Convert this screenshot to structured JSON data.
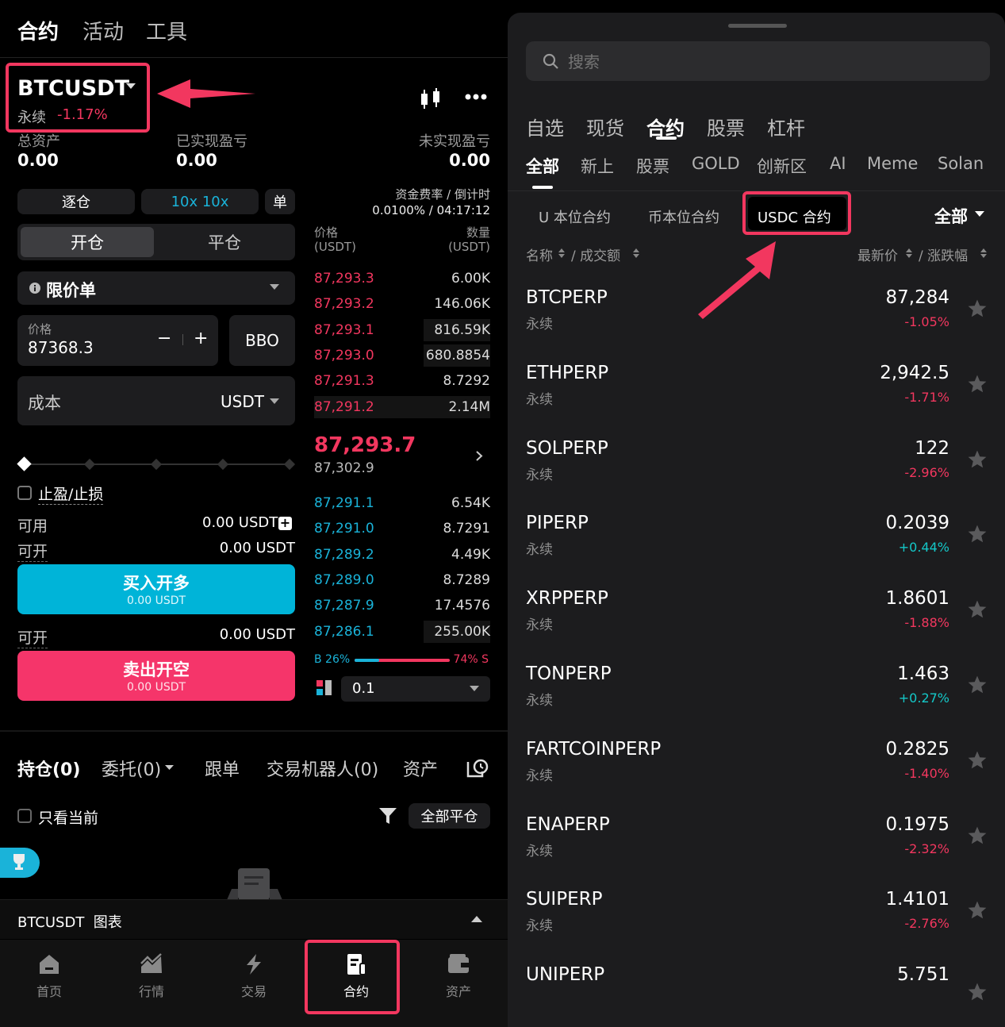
{
  "top_tabs": [
    "合约",
    "活动",
    "工具"
  ],
  "pair": {
    "symbol": "BTCUSDT",
    "type": "永续",
    "change": "-1.17%"
  },
  "account": {
    "total_label": "总资产",
    "total_value": "0.00",
    "realized_label": "已实现盈亏",
    "realized_value": "0.00",
    "unrealized_label": "未实现盈亏",
    "unrealized_value": "0.00"
  },
  "margin": {
    "mode": "逐仓",
    "leverage": "10x 10x",
    "single": "单"
  },
  "funding": {
    "label": "资金费率 / 倒计时",
    "value": "0.0100% / 04:17:12"
  },
  "open_close": {
    "open": "开仓",
    "close": "平仓"
  },
  "order_type": "限价单",
  "price_input": {
    "label": "价格",
    "value": "87368.3",
    "minus": "−",
    "plus": "+",
    "bbo": "BBO"
  },
  "cost": {
    "label": "成本",
    "unit": "USDT"
  },
  "tpsl": "止盈/止损",
  "available": {
    "label": "可用",
    "value": "0.00 USDT"
  },
  "can_open_1": {
    "label": "可开",
    "value": "0.00 USDT"
  },
  "buy_btn": {
    "label": "买入开多",
    "sub": "0.00 USDT"
  },
  "can_open_2": {
    "label": "可开",
    "value": "0.00 USDT"
  },
  "sell_btn": {
    "label": "卖出开空",
    "sub": "0.00 USDT"
  },
  "orderbook": {
    "price_head": "价格\n(USDT)",
    "qty_head": "数量\n(USDT)",
    "asks": [
      {
        "p": "87,293.3",
        "q": "6.00K",
        "w": 0
      },
      {
        "p": "87,293.2",
        "q": "146.06K",
        "w": 0
      },
      {
        "p": "87,293.1",
        "q": "816.59K",
        "w": 0.38
      },
      {
        "p": "87,293.0",
        "q": "680.8854",
        "w": 0.38
      },
      {
        "p": "87,291.3",
        "q": "8.7292",
        "w": 0
      },
      {
        "p": "87,291.2",
        "q": "2.14M",
        "w": 1
      }
    ],
    "last_price": "87,293.7",
    "mark_price": "87,302.9",
    "bids": [
      {
        "p": "87,291.1",
        "q": "6.54K",
        "w": 0
      },
      {
        "p": "87,291.0",
        "q": "8.7291",
        "w": 0
      },
      {
        "p": "87,289.2",
        "q": "4.49K",
        "w": 0
      },
      {
        "p": "87,289.0",
        "q": "8.7289",
        "w": 0
      },
      {
        "p": "87,287.9",
        "q": "17.4576",
        "w": 0
      },
      {
        "p": "87,286.1",
        "q": "255.00K",
        "w": 0.38
      }
    ],
    "ratio_b": "B 26%",
    "ratio_s": "74% S",
    "buy_fraction": 0.26,
    "depth": "0.1"
  },
  "bottom_tabs": [
    "持仓(0)",
    "委托(0)",
    "跟单",
    "交易机器人(0)",
    "资产"
  ],
  "only_current": "只看当前",
  "close_all": "全部平仓",
  "chart_bar": "BTCUSDT  图表",
  "nav": [
    {
      "label": "首页",
      "icon": "home-icon"
    },
    {
      "label": "行情",
      "icon": "market-icon"
    },
    {
      "label": "交易",
      "icon": "trade-icon"
    },
    {
      "label": "合约",
      "icon": "contract-icon"
    },
    {
      "label": "资产",
      "icon": "wallet-icon"
    }
  ],
  "market": {
    "search_placeholder": "搜索",
    "categories": [
      "自选",
      "现货",
      "合约",
      "股票",
      "杠杆"
    ],
    "active_category": "合约",
    "subcats": [
      "全部",
      "新上",
      "股票",
      "GOLD",
      "创新区",
      "AI",
      "Meme",
      "Solan"
    ],
    "contract_types": [
      "U 本位合约",
      "币本位合约",
      "USDC 合约"
    ],
    "filter": "全部",
    "col_name": "名称",
    "col_volume": "/ 成交额",
    "col_price": "最新价",
    "col_change": "/ 涨跌幅",
    "rows": [
      {
        "name": "BTCPERP",
        "type": "永续",
        "price": "87,284",
        "change": "-1.05%",
        "up": false
      },
      {
        "name": "ETHPERP",
        "type": "永续",
        "price": "2,942.5",
        "change": "-1.71%",
        "up": false
      },
      {
        "name": "SOLPERP",
        "type": "永续",
        "price": "122",
        "change": "-2.96%",
        "up": false
      },
      {
        "name": "PIPERP",
        "type": "永续",
        "price": "0.2039",
        "change": "+0.44%",
        "up": true
      },
      {
        "name": "XRPPERP",
        "type": "永续",
        "price": "1.8601",
        "change": "-1.88%",
        "up": false
      },
      {
        "name": "TONPERP",
        "type": "永续",
        "price": "1.463",
        "change": "+0.27%",
        "up": true
      },
      {
        "name": "FARTCOINPERP",
        "type": "永续",
        "price": "0.2825",
        "change": "-1.40%",
        "up": false
      },
      {
        "name": "ENAPERP",
        "type": "永续",
        "price": "0.1975",
        "change": "-2.32%",
        "up": false
      },
      {
        "name": "SUIPERP",
        "type": "永续",
        "price": "1.4101",
        "change": "-2.76%",
        "up": false
      },
      {
        "name": "UNIPERP",
        "type": "",
        "price": "5.751",
        "change": "",
        "up": false
      }
    ]
  },
  "colors": {
    "accent_red": "#f2375f",
    "accent_blue": "#1ab3d9",
    "up_green": "#14c8c8"
  }
}
